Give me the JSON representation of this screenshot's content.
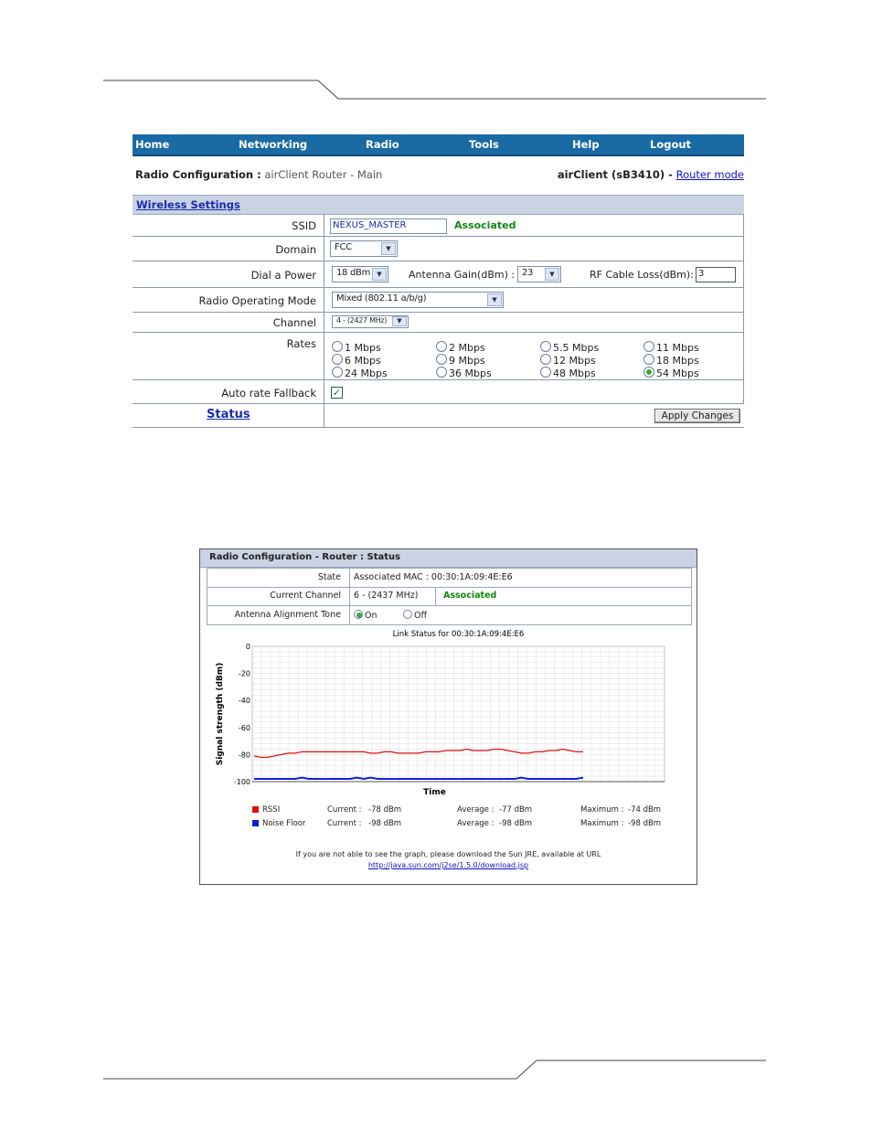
{
  "nav": {
    "items": [
      "Home",
      "Networking",
      "Radio",
      "Tools",
      "Help",
      "Logout"
    ]
  },
  "header": {
    "title_bold": "Radio Configuration :",
    "title_rest": " airClient Router - Main",
    "device": "airClient (sB3410) -",
    "router_mode_link": "Router mode"
  },
  "wireless": {
    "section_title": "Wireless Settings",
    "ssid_label": "SSID",
    "ssid_value": "NEXUS_MASTER",
    "ssid_status": "Associated",
    "domain_label": "Domain",
    "domain_value": "FCC",
    "dial_power_label": "Dial a Power",
    "dial_power_value": "18 dBm",
    "antenna_gain_label": "Antenna Gain(dBm) :",
    "antenna_gain_value": "23",
    "rf_cable_label": "RF Cable Loss(dBm):",
    "rf_cable_value": "3",
    "mode_label": "Radio Operating Mode",
    "mode_value": "Mixed (802.11 a/b/g)",
    "channel_label": "Channel",
    "channel_value": "4 - (2427 MHz)",
    "rates_label": "Rates",
    "rates": [
      "1 Mbps",
      "2 Mbps",
      "5.5 Mbps",
      "11 Mbps",
      "6 Mbps",
      "9 Mbps",
      "12 Mbps",
      "18 Mbps",
      "24 Mbps",
      "36 Mbps",
      "48 Mbps",
      "54 Mbps"
    ],
    "selected_rate": "54 Mbps",
    "fallback_label": "Auto rate Fallback",
    "fallback_checked": true,
    "status_link": "Status",
    "apply_button": "Apply Changes"
  },
  "status_panel": {
    "title": "Radio Configuration - Router : Status",
    "state_label": "State",
    "state_value": "Associated MAC : 00:30:1A:09:4E:E6",
    "channel_label": "Current Channel",
    "channel_value": "6 - (2437 MHz)",
    "channel_status": "Associated",
    "tone_label": "Antenna Alignment Tone",
    "tone_on": "On",
    "tone_off": "Off",
    "tone_selected": "On",
    "note_line1": "If you are not able to see the graph, please download the Sun JRE, available at URL",
    "note_link": "http://java.sun.com/j2se/1.5.0/download.jsp"
  },
  "legend": {
    "rssi": {
      "name": "RSSI",
      "current_label": "Current :",
      "current": "-78 dBm",
      "average_label": "Average :",
      "average": "-77 dBm",
      "maximum_label": "Maximum :",
      "maximum": "-74 dBm"
    },
    "noise": {
      "name": "Noise Floor",
      "current_label": "Current :",
      "current": "-98 dBm",
      "average_label": "Average :",
      "average": "-98 dBm",
      "maximum_label": "Maximum :",
      "maximum": "-98 dBm"
    }
  },
  "chart_data": {
    "type": "line",
    "title": "Link Status for 00:30:1A:09:4E:E6",
    "xlabel": "Time",
    "ylabel": "Signal strength (dBm)",
    "ylim": [
      -100,
      0
    ],
    "yticks": [
      0,
      -20,
      -40,
      -60,
      -80,
      -100
    ],
    "grid": true,
    "series": [
      {
        "name": "RSSI",
        "color": "#e01010",
        "values": [
          -81,
          -82,
          -82,
          -81,
          -80,
          -79,
          -79,
          -78,
          -78,
          -78,
          -78,
          -78,
          -78,
          -78,
          -78,
          -78,
          -78,
          -79,
          -79,
          -78,
          -78,
          -79,
          -79,
          -79,
          -79,
          -78,
          -78,
          -78,
          -77,
          -77,
          -77,
          -76,
          -77,
          -77,
          -77,
          -76,
          -76,
          -77,
          -78,
          -79,
          -79,
          -78,
          -78,
          -77,
          -77,
          -76,
          -77,
          -78,
          -78
        ]
      },
      {
        "name": "Noise Floor",
        "color": "#1020d0",
        "values": [
          -98,
          -98,
          -98,
          -98,
          -98,
          -98,
          -98,
          -97,
          -98,
          -98,
          -98,
          -98,
          -98,
          -98,
          -98,
          -97,
          -98,
          -97,
          -98,
          -98,
          -98,
          -98,
          -98,
          -98,
          -98,
          -98,
          -98,
          -98,
          -98,
          -98,
          -98,
          -98,
          -98,
          -98,
          -98,
          -98,
          -98,
          -98,
          -98,
          -97,
          -98,
          -98,
          -98,
          -98,
          -98,
          -98,
          -98,
          -98,
          -97
        ]
      }
    ]
  }
}
